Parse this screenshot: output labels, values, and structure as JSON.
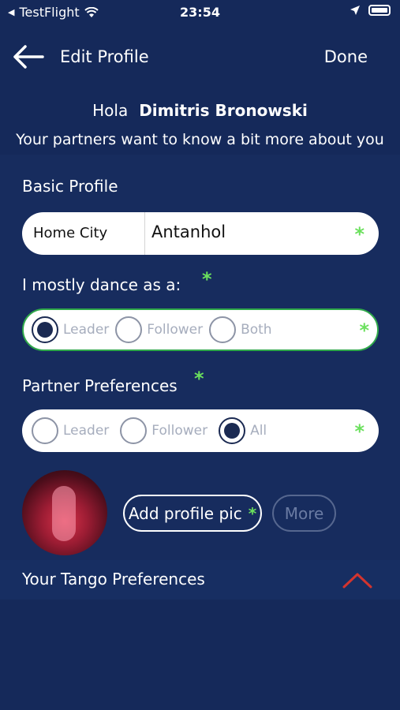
{
  "status_bar": {
    "back_app": "TestFlight",
    "time": "23:54"
  },
  "nav": {
    "title": "Edit Profile",
    "done_label": "Done"
  },
  "greeting": {
    "hola": "Hola",
    "name": "Dimitris Bronowski",
    "subtitle": "Your partners want to know a bit more about you"
  },
  "basic_profile": {
    "label": "Basic Profile",
    "home_city_label": "Home City",
    "home_city_value": "Antanhol",
    "required_mark": "*"
  },
  "dance_role": {
    "label": "I mostly dance as a:",
    "required_mark": "*",
    "options": [
      "Leader",
      "Follower",
      "Both"
    ],
    "selected": "Leader"
  },
  "partner_preferences": {
    "label": "Partner Preferences",
    "required_mark": "*",
    "options": [
      "Leader",
      "Follower",
      "All"
    ],
    "selected": "All"
  },
  "profile_pic": {
    "add_label": "Add profile pic",
    "required_mark": "*",
    "more_label": "More"
  },
  "tango_preferences": {
    "label": "Your Tango Preferences"
  },
  "colors": {
    "background": "#15295a",
    "required_star": "#6be05d",
    "chevron": "#d3342e",
    "selected_border": "#2fa84a"
  },
  "icons": [
    "back-arrow-icon",
    "wifi-icon",
    "location-icon",
    "battery-icon",
    "chevron-up-icon"
  ]
}
